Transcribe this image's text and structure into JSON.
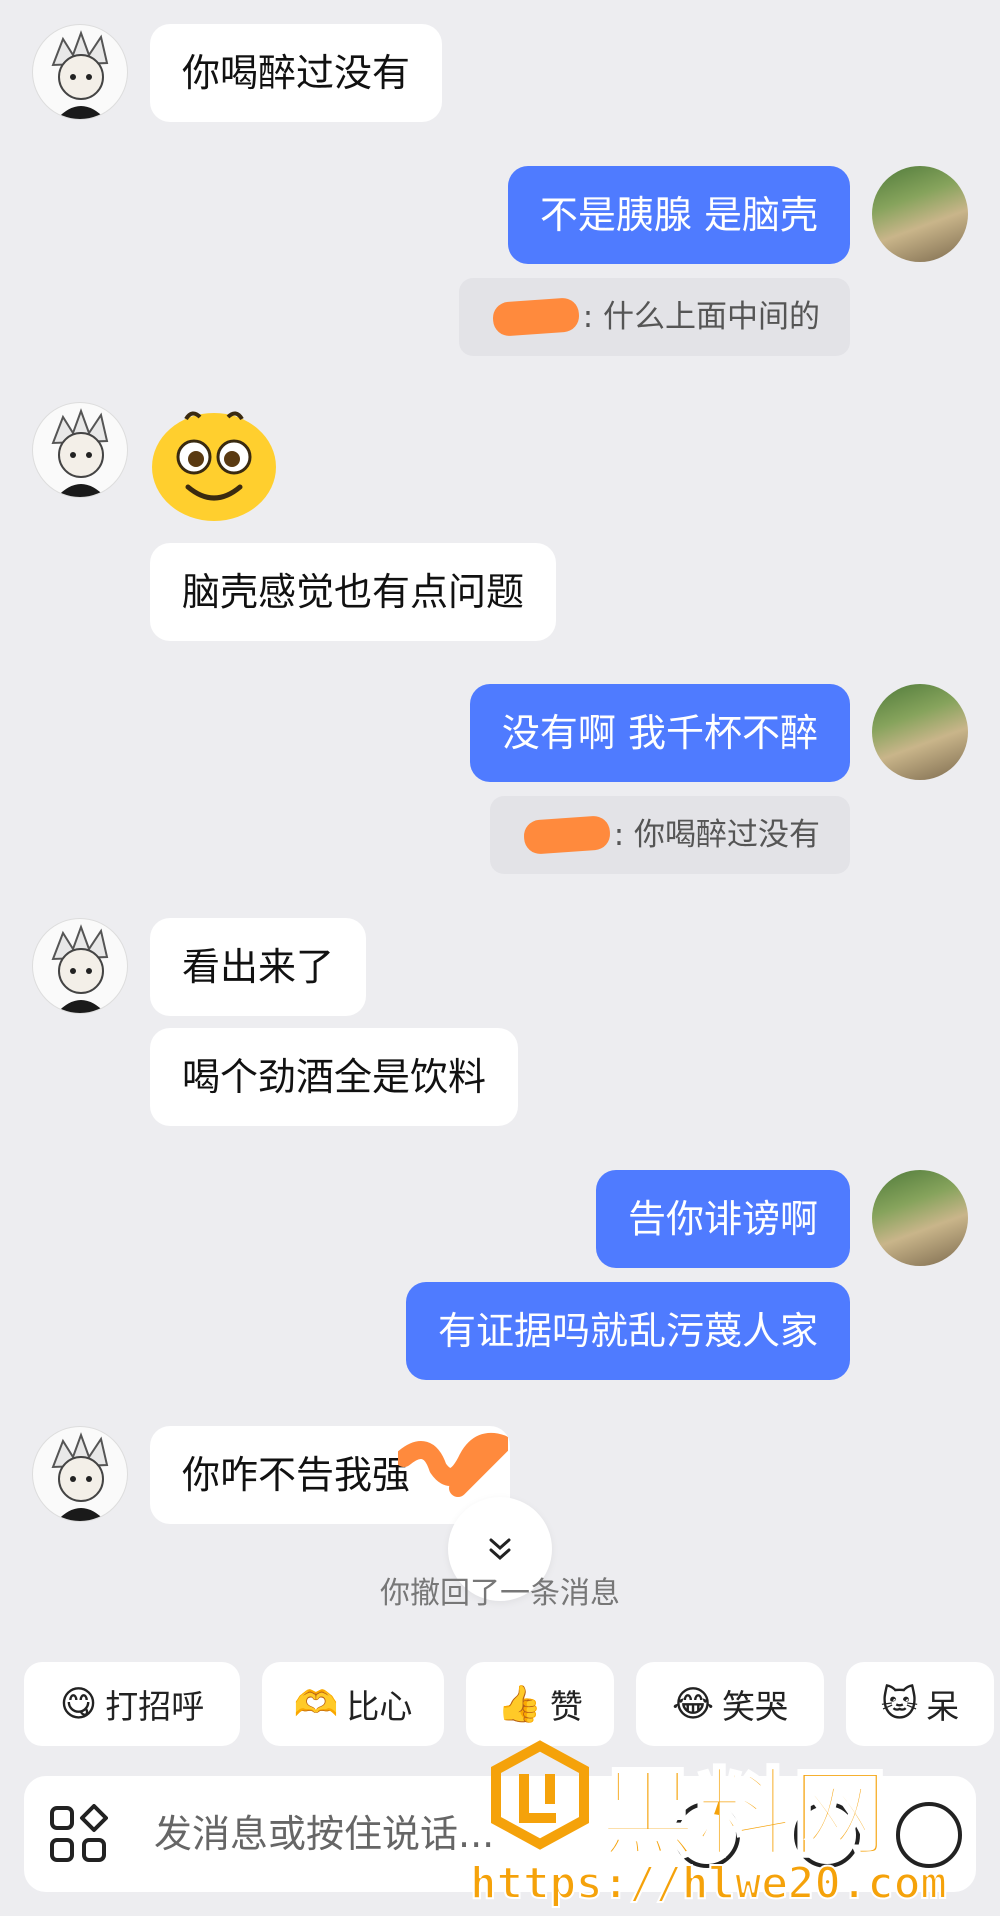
{
  "messages": [
    {
      "text": "你喝醉过没有"
    },
    {
      "text": "不是胰腺 是脑壳"
    },
    {
      "quote": ":  什么上面中间的"
    },
    {
      "emoji": "grinning-face"
    },
    {
      "text": "脑壳感觉也有点问题"
    },
    {
      "text": "没有啊 我千杯不醉"
    },
    {
      "quote": ":  你喝醉过没有"
    },
    {
      "text": "看出来了"
    },
    {
      "text": "喝个劲酒全是饮料"
    },
    {
      "text": "告你诽谤啊"
    },
    {
      "text": "有证据吗就乱污蔑人家"
    },
    {
      "text": "你咋不告我强"
    }
  ],
  "system_note": "你撤回了一条消息",
  "quick_replies": [
    {
      "icon": "😋",
      "label": "打招呼"
    },
    {
      "icon": "🫶",
      "label": "比心"
    },
    {
      "icon": "👍",
      "label": "赞"
    },
    {
      "icon": "😂",
      "label": "笑哭"
    },
    {
      "icon": "🐱",
      "label": "呆"
    }
  ],
  "input": {
    "placeholder": "发消息或按住说话..."
  },
  "watermark": {
    "title": "黑料网",
    "url": "https://hlwe20.com"
  },
  "colors": {
    "outgoing_bubble": "#4f7bff",
    "background": "#ededf0",
    "watermark": "#f5a20a"
  }
}
